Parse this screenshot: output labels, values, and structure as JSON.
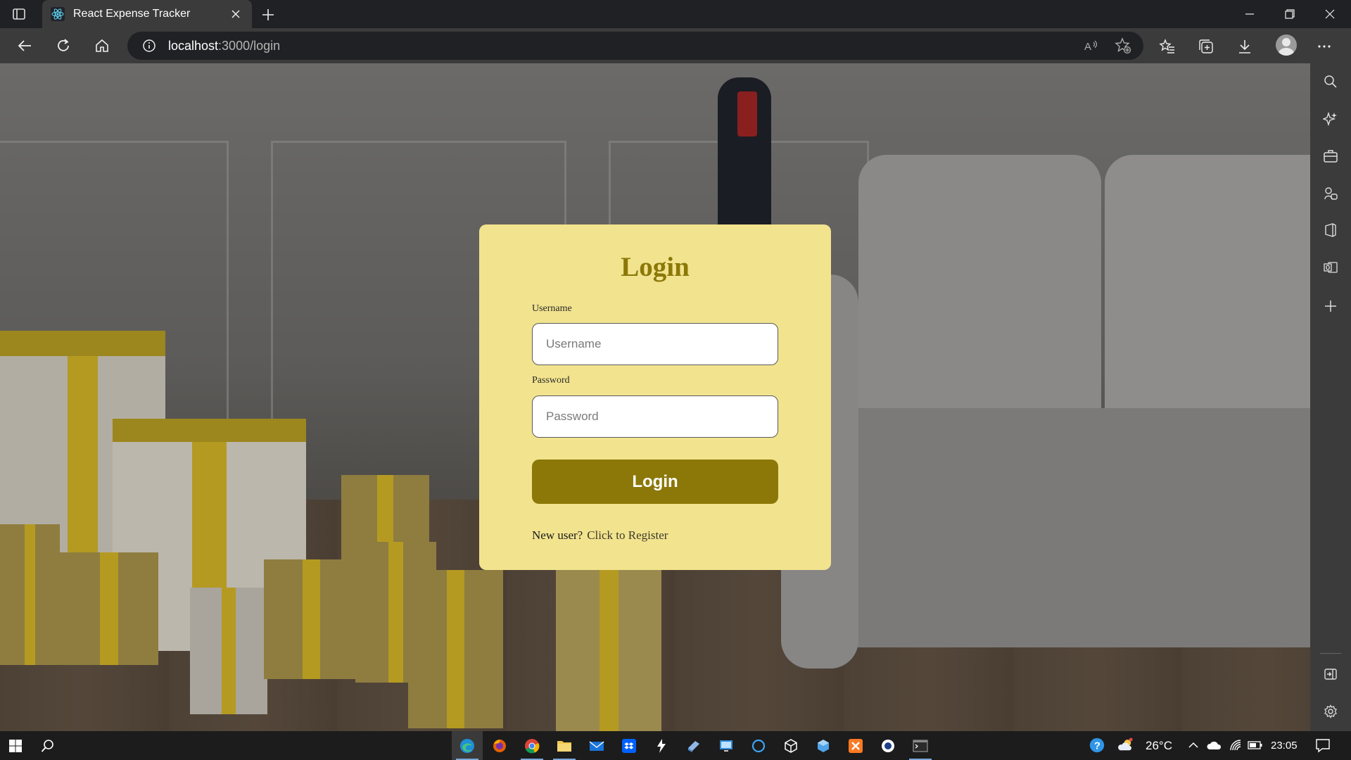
{
  "browser": {
    "tab_title": "React Expense Tracker",
    "url_host": "localhost",
    "url_path": ":3000/login",
    "icons": {
      "tab_actions": "tab-actions-icon",
      "favicon": "react-icon",
      "close_tab": "close-icon",
      "new_tab": "plus-icon",
      "back": "back-arrow-icon",
      "refresh": "refresh-icon",
      "home": "home-icon",
      "site_info": "info-icon",
      "read_aloud": "read-aloud-icon",
      "add_favorite": "star-plus-icon",
      "favorites": "favorites-icon",
      "collections": "collections-icon",
      "downloads": "download-icon",
      "profile": "avatar",
      "more": "more-icon"
    }
  },
  "login": {
    "title": "Login",
    "username_label": "Username",
    "username_placeholder": "Username",
    "username_value": "",
    "password_label": "Password",
    "password_placeholder": "Password",
    "password_value": "",
    "submit_label": "Login",
    "new_user_text": "New user?",
    "register_link": "Click to Register"
  },
  "colors": {
    "card_bg": "#f2e38e",
    "accent": "#8b7808",
    "chrome_dark": "#202124",
    "chrome_light": "#3b3b3b"
  },
  "sidebar": {
    "items": [
      "search-icon",
      "copilot-icon",
      "tools-icon",
      "games-icon",
      "office-icon",
      "outlook-icon",
      "add-icon"
    ],
    "bottom": [
      "hide-sidebar-icon",
      "settings-icon"
    ]
  },
  "taskbar": {
    "temperature": "26°C",
    "time": "23:05"
  }
}
